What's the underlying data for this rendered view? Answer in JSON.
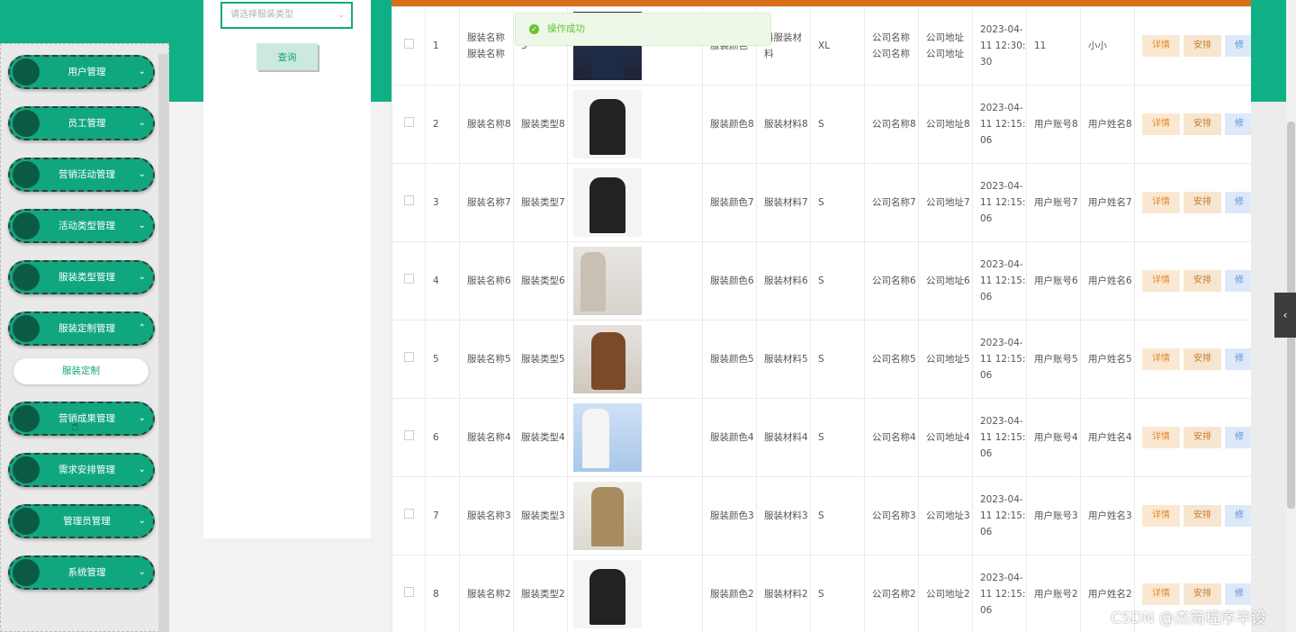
{
  "filter": {
    "type_select_placeholder": "请选择服装类型",
    "query_button": "查询"
  },
  "sidebar": {
    "items": [
      {
        "label": "用户管理",
        "chevron": "⌄"
      },
      {
        "label": "员工管理",
        "chevron": "⌄"
      },
      {
        "label": "营销活动管理",
        "chevron": "⌄"
      },
      {
        "label": "活动类型管理",
        "chevron": "⌄"
      },
      {
        "label": "服装类型管理",
        "chevron": "⌄"
      },
      {
        "label": "服装定制管理",
        "chevron": "⌃"
      },
      {
        "label": "营销成果管理",
        "chevron": "⌄"
      },
      {
        "label": "需求安排管理",
        "chevron": "⌄"
      },
      {
        "label": "管理员管理",
        "chevron": "⌄"
      },
      {
        "label": "系统管理",
        "chevron": "⌄"
      }
    ],
    "sub_item": "服装定制"
  },
  "toast": {
    "message": "操作成功",
    "icon": "check-circle-icon"
  },
  "actions": {
    "detail": "详情",
    "arrange": "安排",
    "edit": "修"
  },
  "table": {
    "rows": [
      {
        "index": "1",
        "name": "服装名称服装名称",
        "type": "3",
        "color": "服装颜色",
        "material": "料服装材料",
        "size": "XL",
        "company": "公司名称公司名称",
        "address": "公司地址公司地址",
        "time": "2023-04-11 12:30:30",
        "account": "11",
        "username": "小小"
      },
      {
        "index": "2",
        "name": "服装名称8",
        "type": "服装类型8",
        "color": "服装颜色8",
        "material": "服装材料8",
        "size": "S",
        "company": "公司名称8",
        "address": "公司地址8",
        "time": "2023-04-11 12:15:06",
        "account": "用户账号8",
        "username": "用户姓名8"
      },
      {
        "index": "3",
        "name": "服装名称7",
        "type": "服装类型7",
        "color": "服装颜色7",
        "material": "服装材料7",
        "size": "S",
        "company": "公司名称7",
        "address": "公司地址7",
        "time": "2023-04-11 12:15:06",
        "account": "用户账号7",
        "username": "用户姓名7"
      },
      {
        "index": "4",
        "name": "服装名称6",
        "type": "服装类型6",
        "color": "服装颜色6",
        "material": "服装材料6",
        "size": "S",
        "company": "公司名称6",
        "address": "公司地址6",
        "time": "2023-04-11 12:15:06",
        "account": "用户账号6",
        "username": "用户姓名6"
      },
      {
        "index": "5",
        "name": "服装名称5",
        "type": "服装类型5",
        "color": "服装颜色5",
        "material": "服装材料5",
        "size": "S",
        "company": "公司名称5",
        "address": "公司地址5",
        "time": "2023-04-11 12:15:06",
        "account": "用户账号5",
        "username": "用户姓名5"
      },
      {
        "index": "6",
        "name": "服装名称4",
        "type": "服装类型4",
        "color": "服装颜色4",
        "material": "服装材料4",
        "size": "S",
        "company": "公司名称4",
        "address": "公司地址4",
        "time": "2023-04-11 12:15:06",
        "account": "用户账号4",
        "username": "用户姓名4"
      },
      {
        "index": "7",
        "name": "服装名称3",
        "type": "服装类型3",
        "color": "服装颜色3",
        "material": "服装材料3",
        "size": "S",
        "company": "公司名称3",
        "address": "公司地址3",
        "time": "2023-04-11 12:15:06",
        "account": "用户账号3",
        "username": "用户姓名3"
      },
      {
        "index": "8",
        "name": "服装名称2",
        "type": "服装类型2",
        "color": "服装颜色2",
        "material": "服装材料2",
        "size": "S",
        "company": "公司名称2",
        "address": "公司地址2",
        "time": "2023-04-11 12:15:06",
        "account": "用户账号2",
        "username": "用户姓名2"
      }
    ]
  },
  "watermark": "CSDN @杰简程序毕设",
  "colors": {
    "brand_green": "#10b086",
    "header_orange": "#d86f1a",
    "success_green": "#67c23a"
  }
}
